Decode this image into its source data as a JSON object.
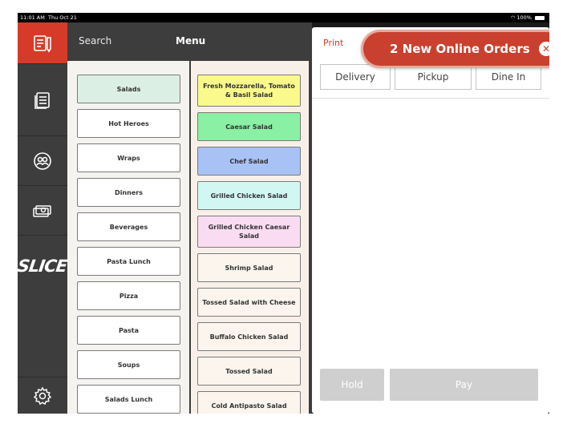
{
  "status_bar": {
    "time": "11:01 AM",
    "date": "Thu Oct 21",
    "battery": "100%"
  },
  "rail": {
    "items": [
      {
        "icon": "order-pad-icon",
        "active": true
      },
      {
        "icon": "orders-list-icon",
        "active": false
      },
      {
        "icon": "customers-icon",
        "active": false
      },
      {
        "icon": "cash-icon",
        "active": false
      },
      {
        "icon": "slice-logo",
        "label": "SLICE"
      },
      {
        "icon": "gear-icon",
        "active": false
      }
    ]
  },
  "menu_header": {
    "search": "Search",
    "title": "Menu"
  },
  "categories": [
    {
      "label": "Salads",
      "selected": true
    },
    {
      "label": "Hot Heroes",
      "selected": false
    },
    {
      "label": "Wraps",
      "selected": false
    },
    {
      "label": "Dinners",
      "selected": false
    },
    {
      "label": "Beverages",
      "selected": false
    },
    {
      "label": "Pasta Lunch",
      "selected": false
    },
    {
      "label": "Pizza",
      "selected": false
    },
    {
      "label": "Pasta",
      "selected": false
    },
    {
      "label": "Soups",
      "selected": false
    },
    {
      "label": "Salads Lunch",
      "selected": false
    }
  ],
  "menu_items": [
    {
      "label": "Fresh Mozzarella, Tomato & Basil Salad",
      "color": "#fafa8c"
    },
    {
      "label": "Caesar Salad",
      "color": "#8af0a4"
    },
    {
      "label": "Chef Salad",
      "color": "#a9c2f5"
    },
    {
      "label": "Grilled Chicken Salad",
      "color": "#d2f7f3"
    },
    {
      "label": "Grilled Chicken Caesar Salad",
      "color": "#fadcf2"
    },
    {
      "label": "Shrimp Salad",
      "color": "#fbf5ee"
    },
    {
      "label": "Tossed Salad with Cheese",
      "color": "#fbf5ee"
    },
    {
      "label": "Buffalo Chicken Salad",
      "color": "#fbf5ee"
    },
    {
      "label": "Tossed Salad",
      "color": "#fbf5ee"
    },
    {
      "label": "Cold Antipasto Salad",
      "color": "#fbf5ee"
    }
  ],
  "order": {
    "print": "Print",
    "types": [
      "Delivery",
      "Pickup",
      "Dine In"
    ],
    "hold": "Hold",
    "pay": "Pay"
  },
  "notification": {
    "text": "2 New Online Orders",
    "close": "✕"
  },
  "colors": {
    "accent": "#d63b2a",
    "rail": "#3d3d3d",
    "selected_category": "#dcefe4"
  }
}
